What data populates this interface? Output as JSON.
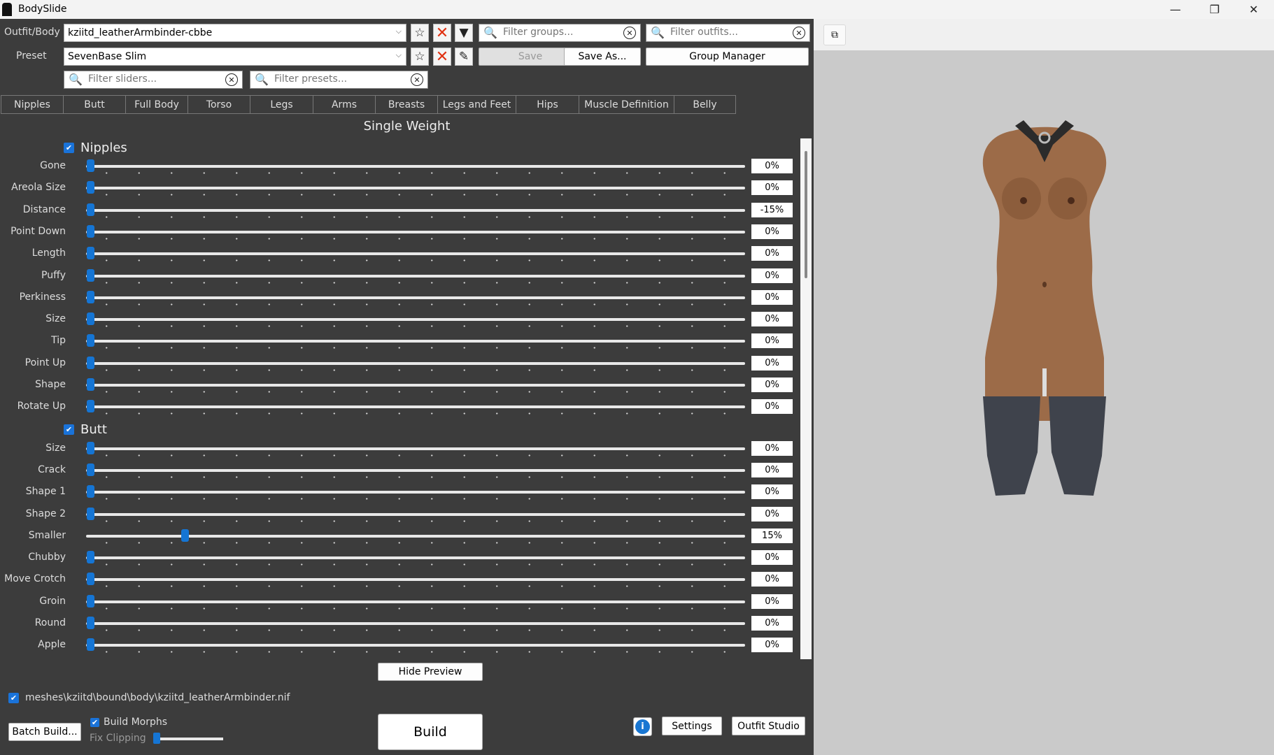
{
  "window": {
    "title": "BodySlide",
    "minimize_icon": "—",
    "restore_icon": "❐",
    "close_icon": "✕"
  },
  "outfit": {
    "label": "Outfit/Body",
    "value": "kziitd_leatherArmbinder-cbbe"
  },
  "preset": {
    "label": "Preset",
    "value": "SevenBase Slim"
  },
  "filters": {
    "groups_placeholder": "Filter groups...",
    "outfits_placeholder": "Filter outfits...",
    "sliders_placeholder": "Filter sliders...",
    "presets_placeholder": "Filter presets..."
  },
  "buttons": {
    "save": "Save",
    "save_as": "Save As...",
    "group_manager": "Group Manager",
    "hide_preview": "Hide Preview",
    "batch_build": "Batch Build...",
    "build": "Build",
    "settings": "Settings",
    "outfit_studio": "Outfit Studio",
    "info": "i"
  },
  "tabs": [
    "Nipples",
    "Butt",
    "Full Body",
    "Torso",
    "Legs",
    "Arms",
    "Breasts",
    "Legs and Feet",
    "Hips",
    "Muscle Definition",
    "Belly"
  ],
  "mode_title": "Single Weight",
  "groups": [
    {
      "name": "Nipples",
      "checked": true,
      "sliders": [
        {
          "name": "Gone",
          "value": "0%",
          "pos": 0
        },
        {
          "name": "Areola Size",
          "value": "0%",
          "pos": 0
        },
        {
          "name": "Distance",
          "value": "-15%",
          "pos": 0
        },
        {
          "name": "Point Down",
          "value": "0%",
          "pos": 0
        },
        {
          "name": "Length",
          "value": "0%",
          "pos": 0
        },
        {
          "name": "Puffy",
          "value": "0%",
          "pos": 0
        },
        {
          "name": "Perkiness",
          "value": "0%",
          "pos": 0
        },
        {
          "name": "Size",
          "value": "0%",
          "pos": 0
        },
        {
          "name": "Tip",
          "value": "0%",
          "pos": 0
        },
        {
          "name": "Point Up",
          "value": "0%",
          "pos": 0
        },
        {
          "name": "Shape",
          "value": "0%",
          "pos": 0
        },
        {
          "name": "Rotate Up",
          "value": "0%",
          "pos": 0
        }
      ]
    },
    {
      "name": "Butt",
      "checked": true,
      "sliders": [
        {
          "name": "Size",
          "value": "0%",
          "pos": 0
        },
        {
          "name": "Crack",
          "value": "0%",
          "pos": 0
        },
        {
          "name": "Shape 1",
          "value": "0%",
          "pos": 0
        },
        {
          "name": "Shape 2",
          "value": "0%",
          "pos": 0
        },
        {
          "name": "Smaller",
          "value": "15%",
          "pos": 0.15
        },
        {
          "name": "Chubby",
          "value": "0%",
          "pos": 0
        },
        {
          "name": "Move Crotch",
          "value": "0%",
          "pos": 0
        },
        {
          "name": "Groin",
          "value": "0%",
          "pos": 0
        },
        {
          "name": "Round",
          "value": "0%",
          "pos": 0
        },
        {
          "name": "Apple",
          "value": "0%",
          "pos": 0
        }
      ]
    }
  ],
  "output_file": {
    "checked": true,
    "path": "meshes\\kziitd\\bound\\body\\kziitd_leatherArmbinder.nif"
  },
  "build_morphs": {
    "label": "Build Morphs",
    "checked": true
  },
  "fix_clipping": {
    "label": "Fix Clipping",
    "level": 0
  },
  "colors": {
    "accent": "#1575d4",
    "panel": "#3c3c3c",
    "preview_bg": "#cacaca",
    "skin": "#9c6b48",
    "boots": "#3f434c"
  }
}
